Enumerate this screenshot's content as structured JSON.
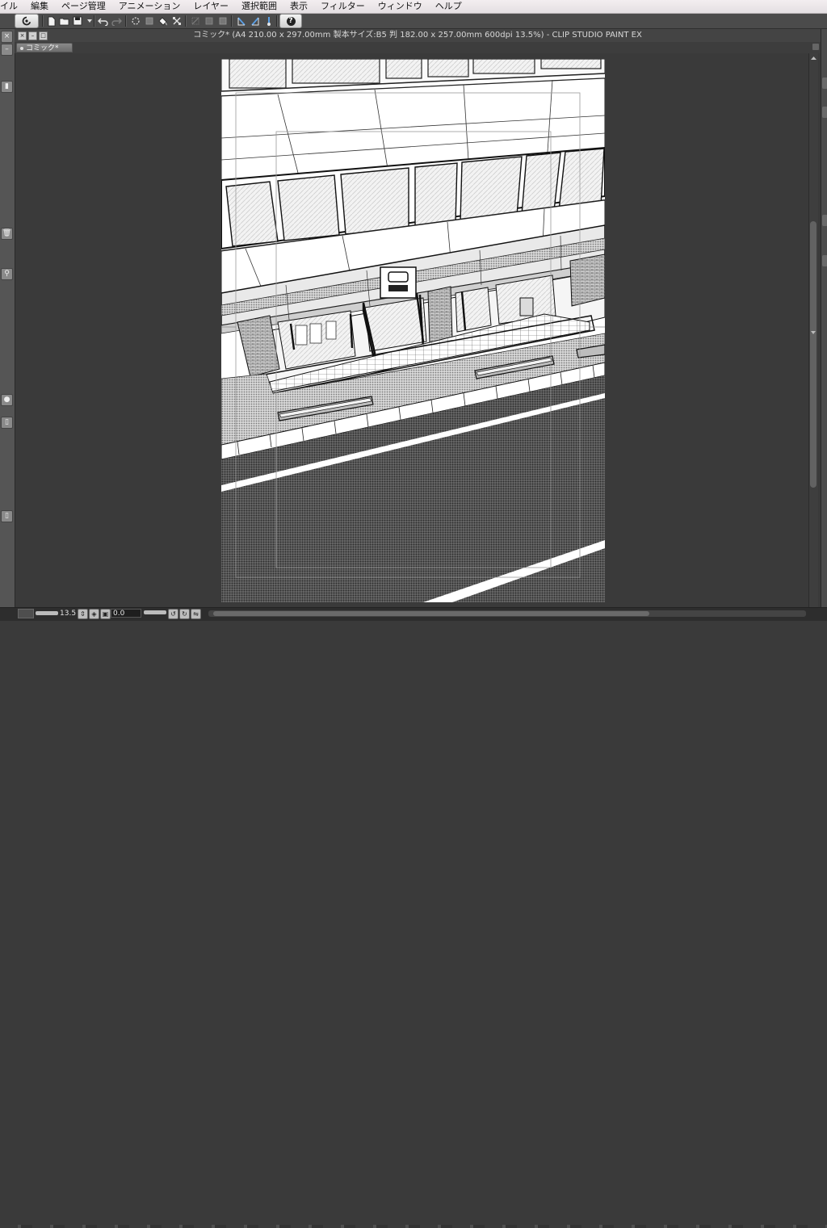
{
  "menubar": {
    "items": [
      "イル",
      "編集",
      "ページ管理",
      "アニメーション",
      "レイヤー",
      "選択範囲",
      "表示",
      "フィルター",
      "ウィンドウ",
      "ヘルプ"
    ]
  },
  "toolbar": {
    "help_label": "?"
  },
  "document": {
    "window_title": "コミック* (A4 210.00 x 297.00mm 製本サイズ:B5 判 182.00 x 257.00mm 600dpi 13.5%)  - CLIP STUDIO PAINT EX",
    "tab_label": "コミック*"
  },
  "status": {
    "zoom": "13.5",
    "rotation": "0.0"
  },
  "colors": {
    "accent": "#4a90d9",
    "panel": "#4b4b4b",
    "canvas_bg": "#3a3a3a"
  }
}
